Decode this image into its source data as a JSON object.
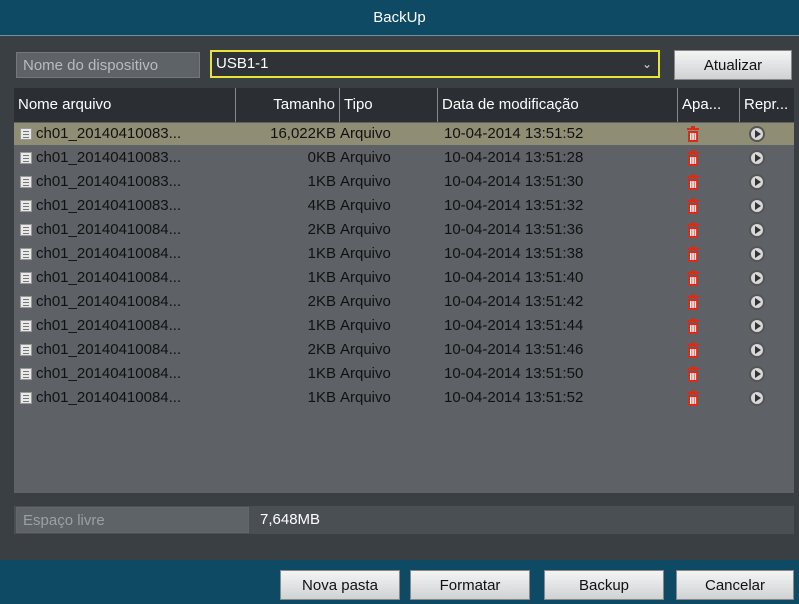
{
  "window": {
    "title": "BackUp"
  },
  "device": {
    "label": "Nome do dispositivo",
    "selected": "USB1-1",
    "refresh_label": "Atualizar"
  },
  "table": {
    "columns": [
      "Nome arquivo",
      "Tamanho",
      "Tipo",
      "Data de modificação",
      "Apa...",
      "Repr..."
    ],
    "rows": [
      {
        "name": "ch01_20140410083...",
        "size": "16,022KB",
        "type": "Arquivo",
        "date": "10-04-2014 13:51:52"
      },
      {
        "name": "ch01_20140410083...",
        "size": "0KB",
        "type": "Arquivo",
        "date": "10-04-2014 13:51:28"
      },
      {
        "name": "ch01_20140410083...",
        "size": "1KB",
        "type": "Arquivo",
        "date": "10-04-2014 13:51:30"
      },
      {
        "name": "ch01_20140410083...",
        "size": "4KB",
        "type": "Arquivo",
        "date": "10-04-2014 13:51:32"
      },
      {
        "name": "ch01_20140410084...",
        "size": "2KB",
        "type": "Arquivo",
        "date": "10-04-2014 13:51:36"
      },
      {
        "name": "ch01_20140410084...",
        "size": "1KB",
        "type": "Arquivo",
        "date": "10-04-2014 13:51:38"
      },
      {
        "name": "ch01_20140410084...",
        "size": "1KB",
        "type": "Arquivo",
        "date": "10-04-2014 13:51:40"
      },
      {
        "name": "ch01_20140410084...",
        "size": "2KB",
        "type": "Arquivo",
        "date": "10-04-2014 13:51:42"
      },
      {
        "name": "ch01_20140410084...",
        "size": "1KB",
        "type": "Arquivo",
        "date": "10-04-2014 13:51:44"
      },
      {
        "name": "ch01_20140410084...",
        "size": "2KB",
        "type": "Arquivo",
        "date": "10-04-2014 13:51:46"
      },
      {
        "name": "ch01_20140410084...",
        "size": "1KB",
        "type": "Arquivo",
        "date": "10-04-2014 13:51:50"
      },
      {
        "name": "ch01_20140410084...",
        "size": "1KB",
        "type": "Arquivo",
        "date": "10-04-2014 13:51:52"
      }
    ],
    "row_icons": {
      "file": "file-icon",
      "delete": "trash-icon",
      "play": "play-icon"
    },
    "selected_row": 0
  },
  "free_space": {
    "label": "Espaço livre",
    "value": "7,648MB"
  },
  "footer": {
    "new_folder": "Nova pasta",
    "format": "Formatar",
    "backup": "Backup",
    "cancel": "Cancelar"
  },
  "colors": {
    "title_bar": "#0e4a64",
    "focus_border": "#e8e33a",
    "selected_row": "#8f8e75",
    "delete_icon": "#d62c1a"
  }
}
